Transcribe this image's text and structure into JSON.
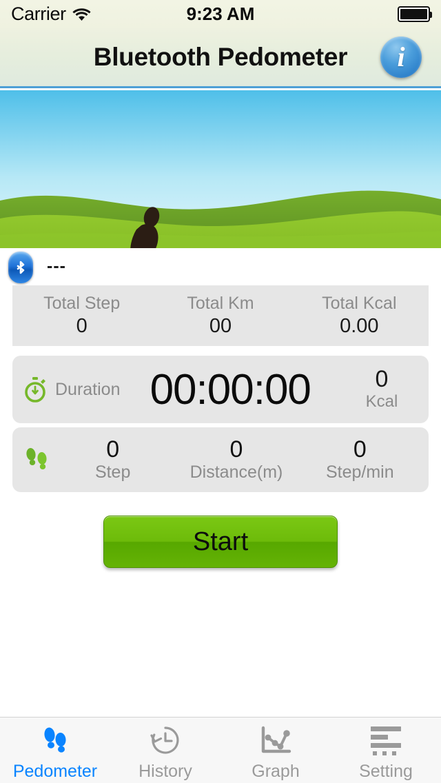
{
  "status_bar": {
    "carrier": "Carrier",
    "wifi_icon": "wifi-icon",
    "time": "9:23 AM",
    "battery_icon": "battery-full-icon"
  },
  "nav_bar": {
    "title": "Bluetooth Pedometer",
    "info_button_label": "i",
    "info_icon": "info-circle-icon",
    "accent_border": "#4d9fd6"
  },
  "hero": {
    "image_name": "runner-silhouette-illustration",
    "sky_top_color": "#5cc3ec",
    "sky_bottom_color": "#dff4fb",
    "hill_back_color": "#6ba52a",
    "hill_front_color": "#8cc529",
    "runner_color": "#2b1d14"
  },
  "bluetooth": {
    "icon": "bluetooth-icon",
    "status_text": "---",
    "icon_color": "#1f72d8"
  },
  "totals": {
    "columns": [
      {
        "label": "Total Step",
        "value": "0"
      },
      {
        "label": "Total Km",
        "value": "00"
      },
      {
        "label": "Total Kcal",
        "value": "0.00"
      }
    ]
  },
  "duration": {
    "icon": "stopwatch-icon",
    "icon_color": "#76b82a",
    "label": "Duration",
    "time": "00:00:00",
    "kcal_value": "0",
    "kcal_unit": "Kcal"
  },
  "steps": {
    "icon": "footprints-icon",
    "icon_color": "#76b82a",
    "columns": [
      {
        "value": "0",
        "label": "Step"
      },
      {
        "value": "0",
        "label": "Distance(m)"
      },
      {
        "value": "0",
        "label": "Step/min"
      }
    ]
  },
  "start_button": {
    "label": "Start",
    "color": "#6dbb0a"
  },
  "tab_bar": {
    "active_index": 0,
    "active_color": "#0a84ff",
    "inactive_color": "#9a9a9a",
    "tabs": [
      {
        "label": "Pedometer",
        "icon": "footprints-icon"
      },
      {
        "label": "History",
        "icon": "clock-history-icon"
      },
      {
        "label": "Graph",
        "icon": "line-chart-icon"
      },
      {
        "label": "Setting",
        "icon": "list-settings-icon"
      }
    ]
  }
}
